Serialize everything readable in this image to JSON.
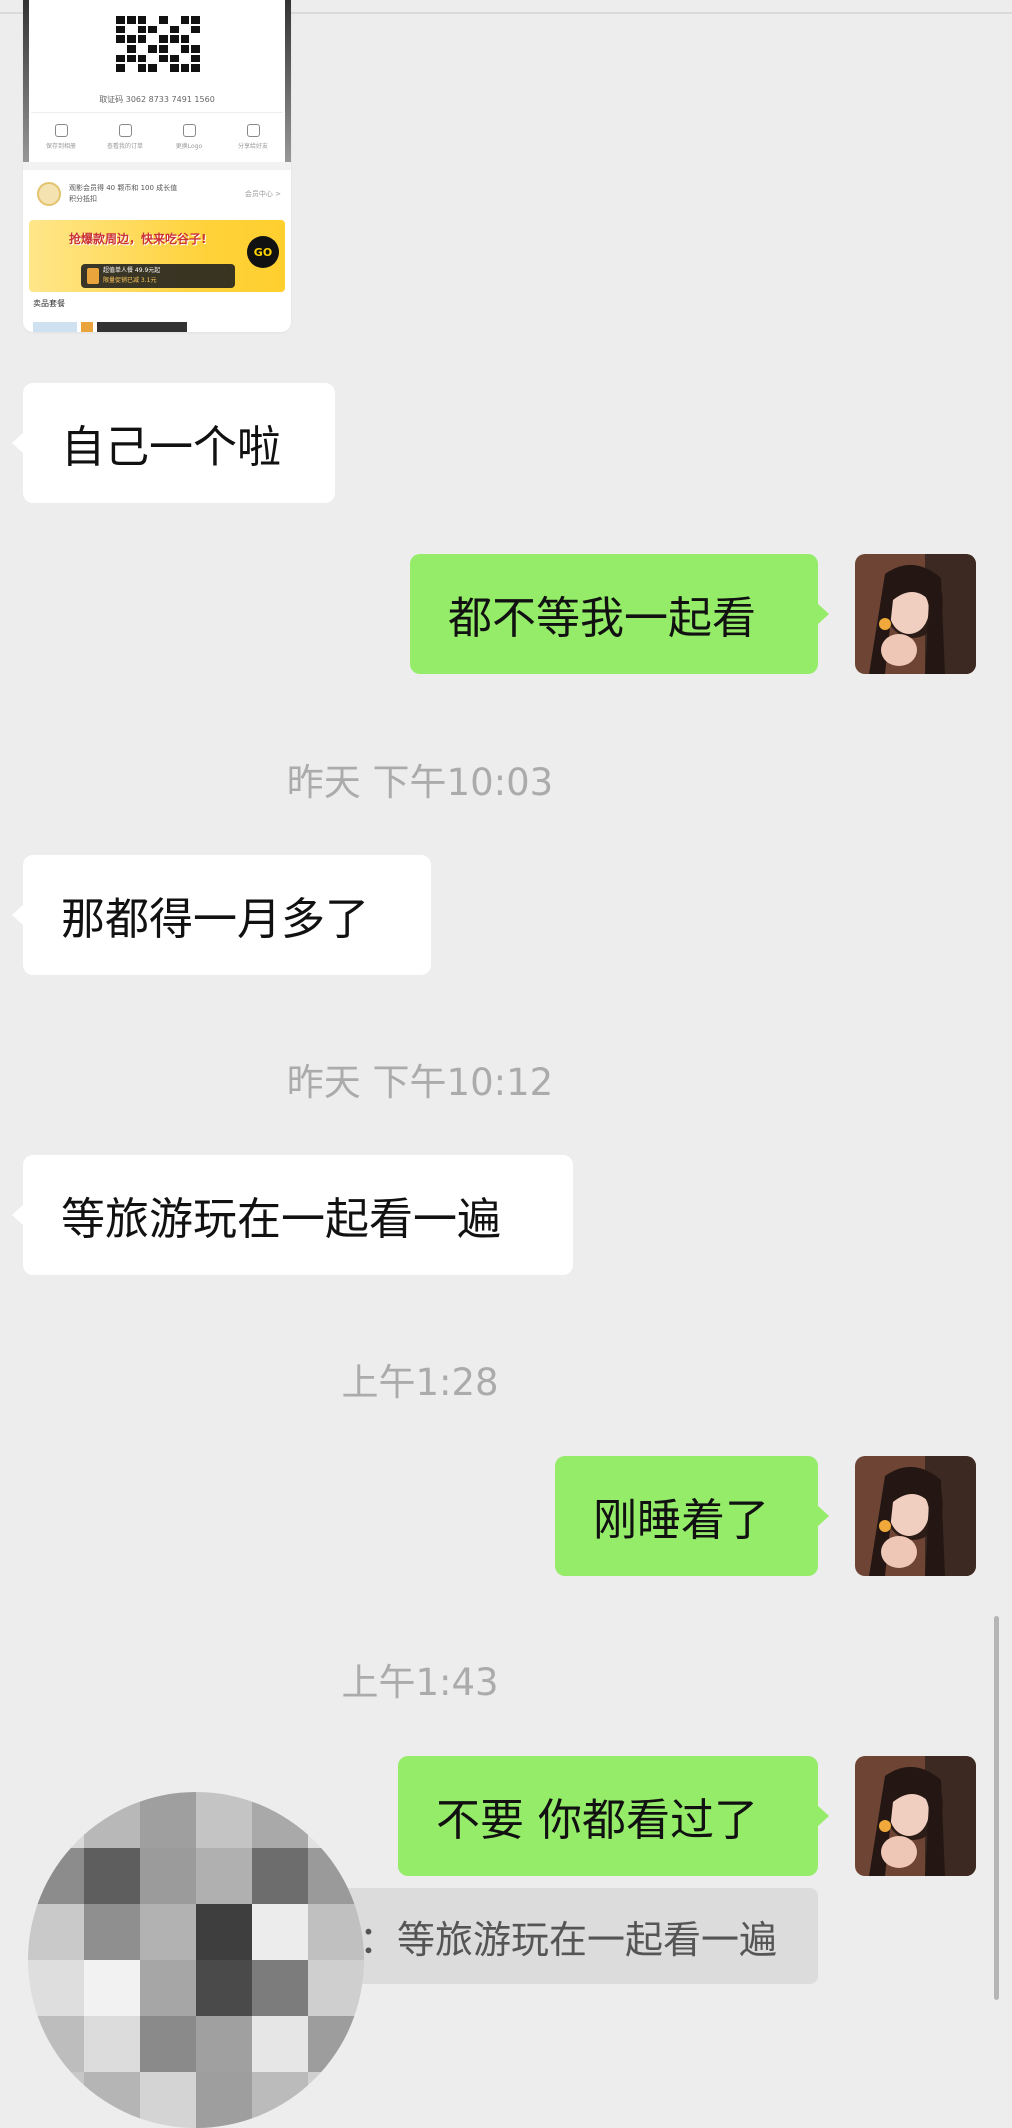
{
  "colors": {
    "background": "#ededed",
    "incoming_bubble": "#ffffff",
    "outgoing_bubble": "#95ec69",
    "timestamp_text": "#ababab",
    "quote_background": "#dcdcdc"
  },
  "shared_screenshot": {
    "code_text": "取证码 3062 8733 7491 1560",
    "actions": [
      "保存到相册",
      "查看我的订单",
      "更换Logo",
      "分享给好友"
    ],
    "member_line1": "观影会员得 40 颗币和 100 成长值",
    "member_line2": "积分抵扣",
    "member_link": "会员中心 >",
    "banner_text": "抢爆款周边，快来吃谷子!",
    "banner_button": "GO",
    "banner_pill_line1": "超值单人餐 49.9元起",
    "banner_pill_line2": "限量促销已减 3.1元",
    "footer_title": "卖品套餐"
  },
  "messages": [
    {
      "side": "in",
      "text": "自己一个啦"
    },
    {
      "side": "out",
      "text": "都不等我一起看"
    },
    {
      "type": "time",
      "text": "昨天 下午10:03"
    },
    {
      "side": "in",
      "text": "那都得一月多了"
    },
    {
      "type": "time",
      "text": "昨天 下午10:12"
    },
    {
      "side": "in",
      "text": "等旅游玩在一起看一遍"
    },
    {
      "type": "time",
      "text": "上午1:28"
    },
    {
      "side": "out",
      "text": "刚睡着了"
    },
    {
      "type": "time",
      "text": "上午1:43"
    },
    {
      "side": "out",
      "text": "不要 你都看过了"
    }
  ],
  "quote": {
    "text": "：等旅游玩在一起看一遍"
  },
  "icons": {
    "avatar": "user-avatar-photo",
    "mosaic": "pixelated-privacy-mosaic"
  }
}
